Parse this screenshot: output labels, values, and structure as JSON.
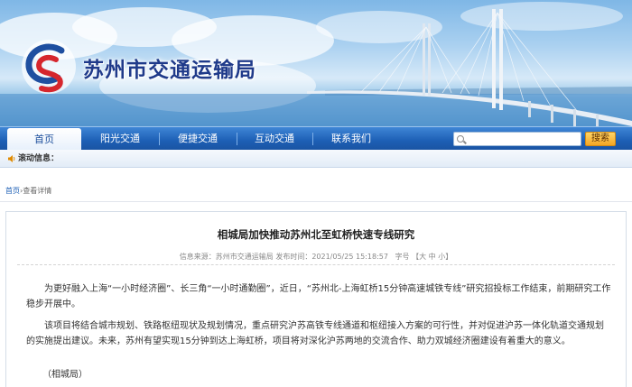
{
  "site": {
    "title": "苏州市交通运输局"
  },
  "nav": {
    "items": [
      {
        "label": "首页",
        "active": true
      },
      {
        "label": "阳光交通",
        "active": false
      },
      {
        "label": "便捷交通",
        "active": false
      },
      {
        "label": "互动交通",
        "active": false
      },
      {
        "label": "联系我们",
        "active": false
      }
    ],
    "search_value": "",
    "search_button": "搜索"
  },
  "ticker": {
    "label": "滚动信息："
  },
  "breadcrumb": {
    "home": "首页",
    "separator": "›",
    "current": "查看详情"
  },
  "article": {
    "title": "相城局加快推动苏州北至虹桥快速专线研究",
    "meta": {
      "source": "信息来源：苏州市交通运输局",
      "published": "发布时间：2021/05/25 15:18:57",
      "font_size_label": "字号",
      "font_sizes": [
        "大",
        "中",
        "小"
      ]
    },
    "paragraphs": [
      "为更好融入上海“一小时经济圈”、长三角“一小时通勤圈”，近日，“苏州北-上海虹桥15分钟高速城铁专线”研究招投标工作结束，前期研究工作稳步开展中。",
      "该项目将结合城市规划、铁路枢纽现状及规划情况，重点研究沪苏高铁专线通道和枢纽接入方案的可行性，并对促进沪苏一体化轨道交通规划的实施提出建议。未来，苏州有望实现15分钟到达上海虹桥，项目将对深化沪苏两地的交流合作、助力双城经济圈建设有着重大的意义。"
    ],
    "signature": "（相城局）"
  },
  "colors": {
    "nav_blue": "#1d5fb5",
    "title_blue": "#1f3a8a",
    "search_orange": "#f4a623"
  }
}
